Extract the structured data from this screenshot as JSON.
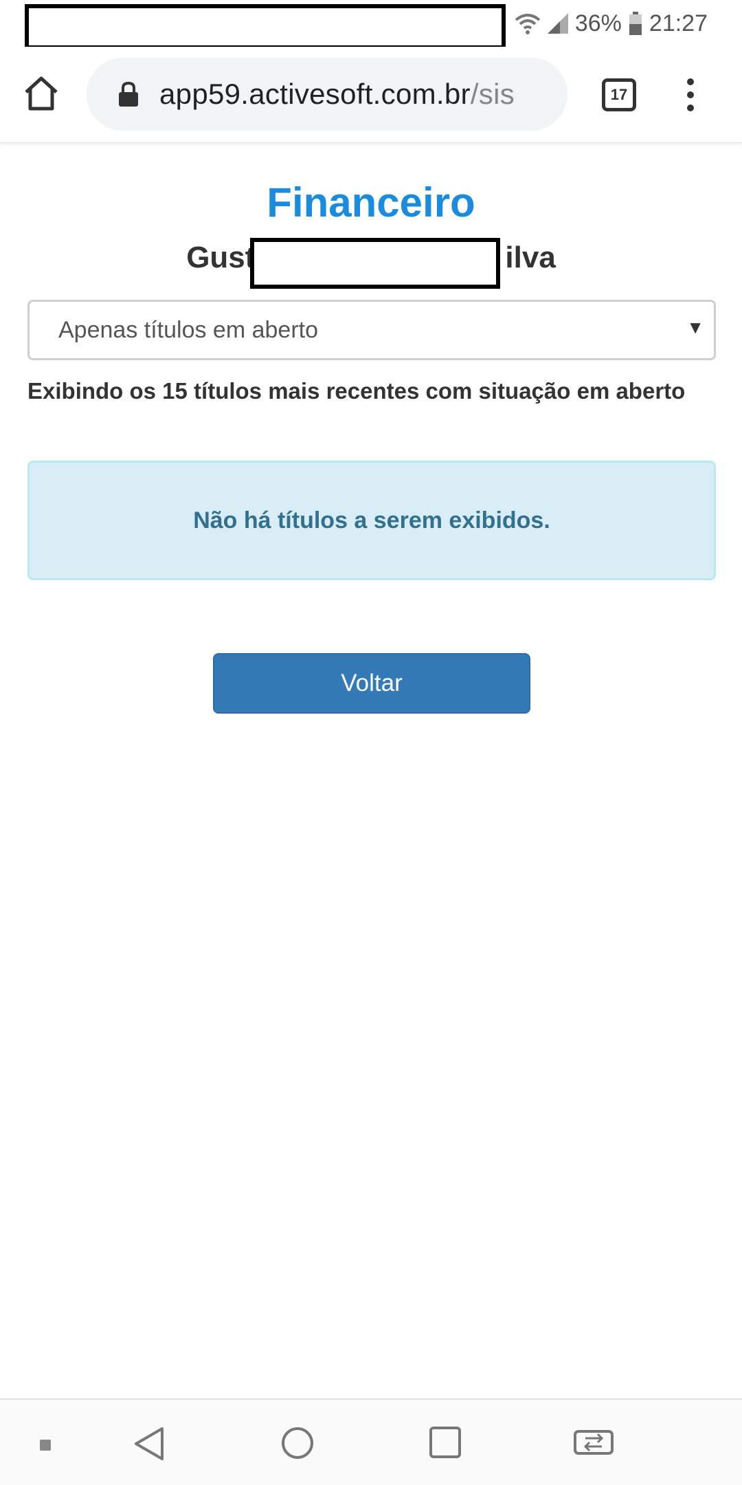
{
  "status_bar": {
    "battery_percent": "36%",
    "time": "21:27"
  },
  "browser": {
    "url_main": "app59.activesoft.com.br",
    "url_rest": "/sis",
    "tab_count": "17"
  },
  "page": {
    "title": "Financeiro",
    "user_name_start": "Gust",
    "user_name_end": "ilva",
    "filter_selected": "Apenas títulos em aberto",
    "info_text": "Exibindo os 15 títulos mais recentes com situação em aberto",
    "empty_message": "Não há títulos a serem exibidos.",
    "back_button": "Voltar"
  },
  "colors": {
    "title": "#1a8cde",
    "alert_bg": "#d9edf7",
    "alert_text": "#31708f",
    "button": "#337ab7"
  },
  "icons": {
    "wifi": "wifi-icon",
    "signal": "signal-icon",
    "battery": "battery-icon",
    "home": "home-icon",
    "lock": "lock-icon",
    "menu": "more-vertical-icon"
  }
}
